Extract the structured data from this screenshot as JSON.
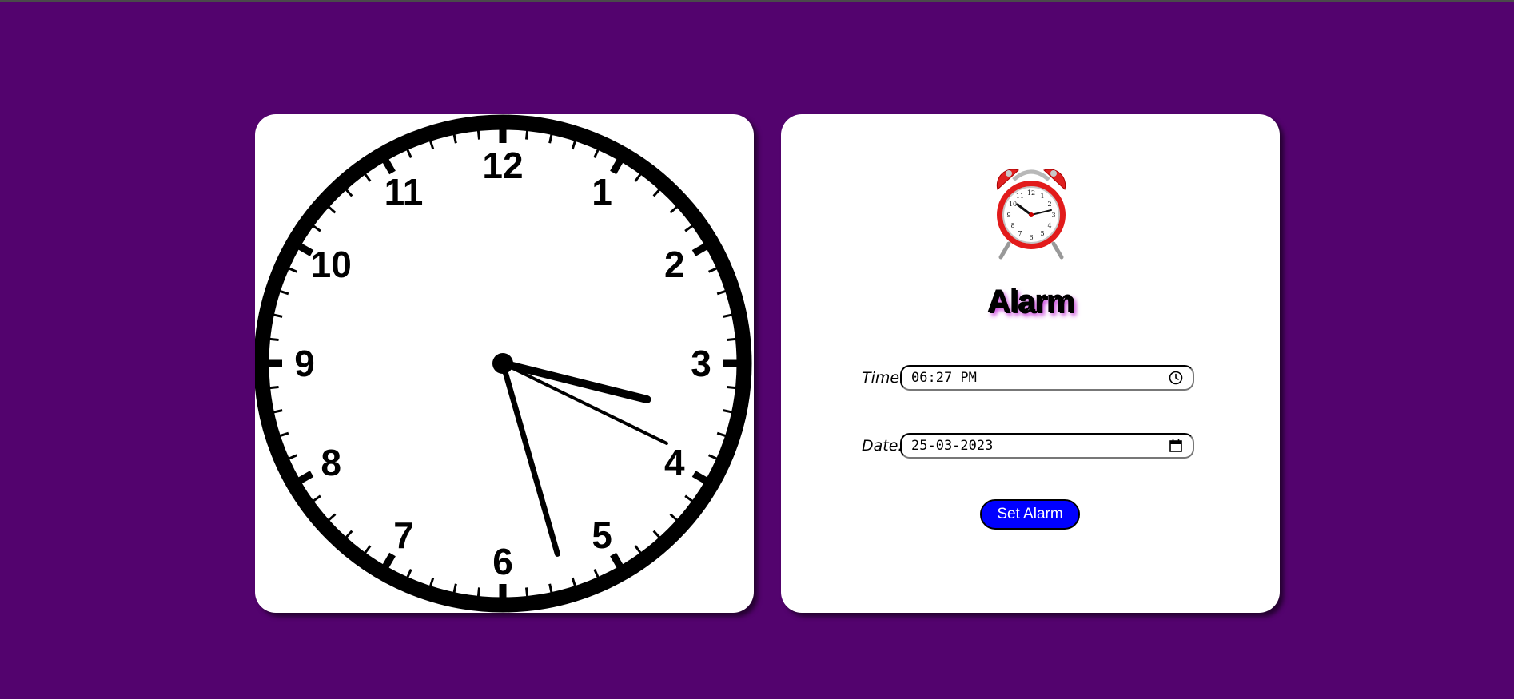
{
  "clock": {
    "numerals": [
      "12",
      "1",
      "2",
      "3",
      "4",
      "5",
      "6",
      "7",
      "8",
      "9",
      "10",
      "11"
    ],
    "hour_angle_deg": 104,
    "minute_angle_deg": 164,
    "second_angle_deg": 116,
    "face_color": "#ffffff",
    "ink_color": "#000000"
  },
  "alarm": {
    "icon": "alarm-clock-icon",
    "title": "Alarm",
    "time_label": "Time:",
    "time_value": "06:27 PM",
    "time_icon": "clock-icon",
    "date_label": "Date:",
    "date_value": "25-03-2023",
    "date_icon": "calendar-icon",
    "button_label": "Set Alarm"
  },
  "colors": {
    "background": "#53036e",
    "button": "#0000ff",
    "title_glow": "#c32bd8"
  }
}
